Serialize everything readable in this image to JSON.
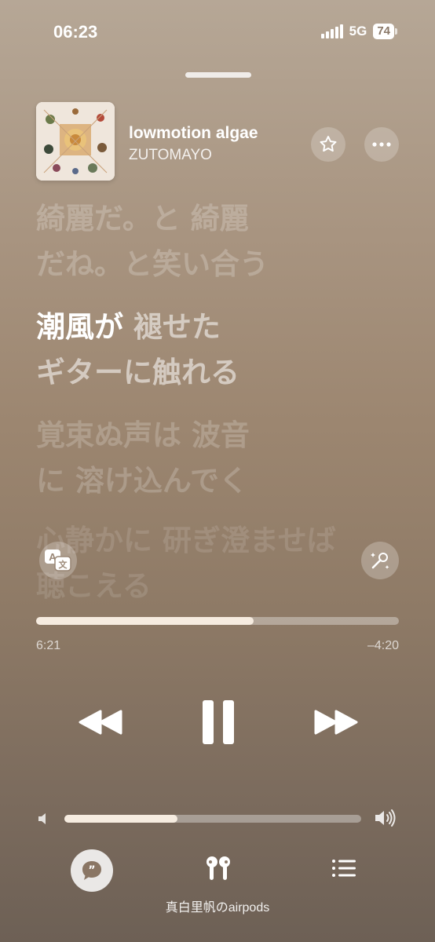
{
  "status_bar": {
    "time": "06:23",
    "network": "5G",
    "battery": "74"
  },
  "now_playing": {
    "title": "lowmotion algae",
    "artist": "ZUTOMAYO",
    "favorite_icon": "star-icon",
    "more_icon": "ellipsis-icon"
  },
  "lyrics": {
    "previous": "綺麗だ。と 綺麗\nだね。と笑い合う",
    "current_sung": "潮風が ",
    "current_unsung": "褪せた\nギターに触れる",
    "next": "覚束ぬ声は 波音\nに 溶け込んでく",
    "after": "心静かに 研ぎ澄ませば\n聴こえる"
  },
  "lyric_actions": {
    "translate_icon": "translate-icon",
    "karaoke_icon": "microphone-sparkle-icon"
  },
  "playback": {
    "elapsed": "6:21",
    "remaining": "–4:20",
    "progress": 0.6,
    "state": "playing"
  },
  "volume": {
    "level": 0.38
  },
  "bottom_bar": {
    "lyrics_icon": "quote-bubble-icon",
    "airplay_icon": "airpods-icon",
    "device_label": "真白里帆のairpods",
    "queue_icon": "list-icon"
  },
  "colors": {
    "accent_fill": "#f6ece0"
  }
}
